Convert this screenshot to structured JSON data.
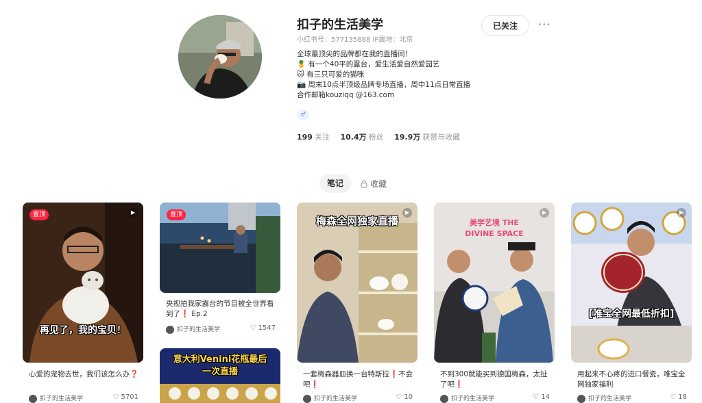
{
  "profile": {
    "nickname": "扣子的生活美学",
    "meta": "小红书号：577135888  IP属地：北京",
    "follow_label": "已关注",
    "more_label": "···",
    "bio": [
      "全球最顶尖的品牌都在我的直播间！",
      "🍍 有一个40平的露台，爱生活爱自然爱园艺",
      "🐱 有三只可爱的猫咪",
      "📷 周末10点半顶级品牌专场直播，周中11点日常直播",
      "合作邮箱kouziqq @163.com"
    ],
    "gender_icon": "♂",
    "stats": {
      "following_value": "199",
      "following_label": "关注",
      "fans_value": "10.4万",
      "fans_label": "粉丝",
      "likes_value": "19.9万",
      "likes_label": "获赞与收藏"
    }
  },
  "tabs": {
    "notes": "笔记",
    "collect": "收藏"
  },
  "pin_label": "置顶",
  "cards": [
    {
      "title": "心爱的宠物去世，我们该怎么办❓",
      "author": "扣子的生活美学",
      "likes": "5701",
      "overlay": "再见了，我的宝贝！"
    },
    {
      "title": "央视拍我家露台的节目被全世界看到了❗ Ep.2",
      "author": "扣子的生活美学",
      "likes": "1547"
    },
    {
      "overlay": "意大利Venini花瓶最后一次直播"
    },
    {
      "title": "一套梅森器皿换一台特斯拉❗不会吧❗",
      "author": "扣子的生活美学",
      "likes": "10",
      "overlay": "梅森全网独家直播"
    },
    {
      "title": "不到300就能买到德国梅森，太扯了吧❗",
      "author": "扣子的生活美学",
      "likes": "14",
      "overlay": "美学艺境 THE DIVINE SPACE"
    },
    {
      "title": "用起来不心疼的进口餐瓷，唯宝全网独家福利",
      "author": "扣子的生活美学",
      "likes": "18",
      "overlay": "[唯宝全网最低折扣]"
    }
  ]
}
